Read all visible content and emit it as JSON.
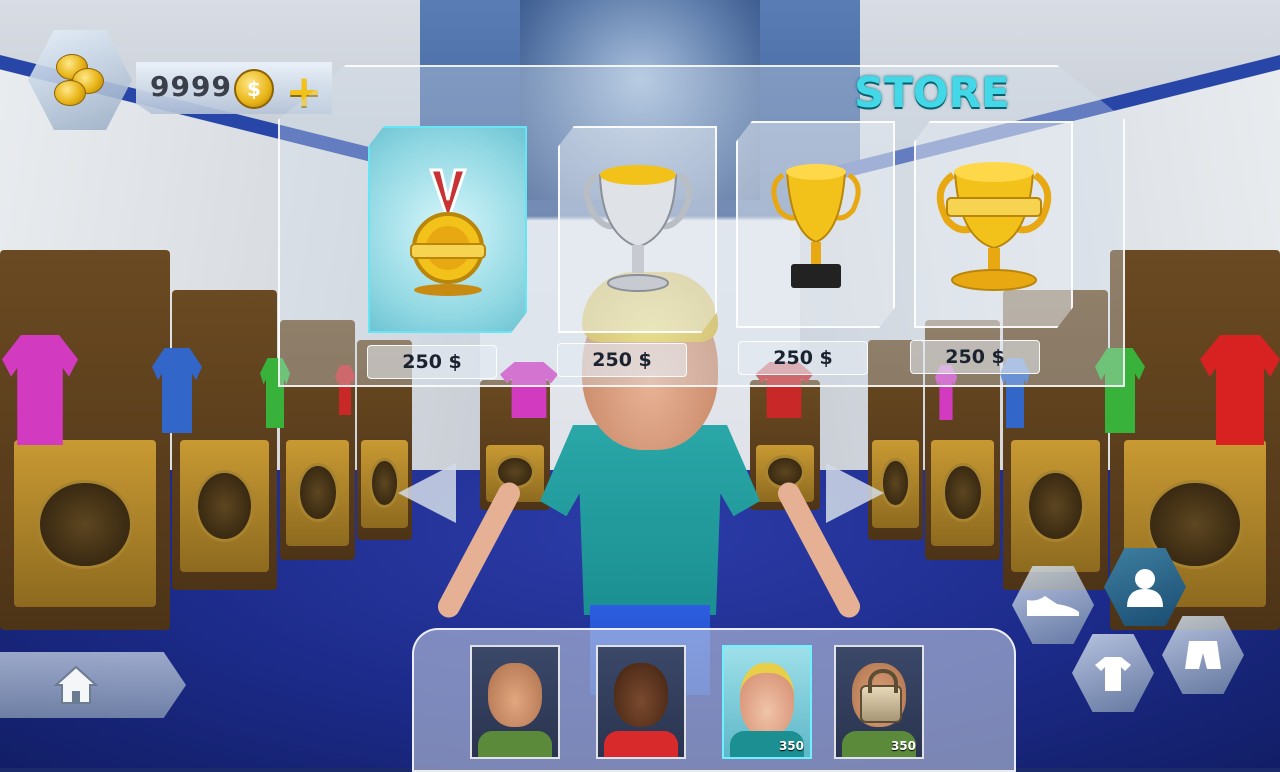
{
  "currency": {
    "balance": "9999",
    "coin_symbol": "$",
    "add_label": "+"
  },
  "store": {
    "title": "STORE",
    "items": [
      {
        "name": "gold-medal",
        "price": "250 $",
        "selected": true
      },
      {
        "name": "silver-cup",
        "price": "250 $",
        "selected": false
      },
      {
        "name": "gold-trophy-small",
        "price": "250 $",
        "selected": false
      },
      {
        "name": "gold-trophy-large",
        "price": "250 $",
        "selected": false
      }
    ]
  },
  "characters": [
    {
      "name": "spiky-hair-boy",
      "price": "",
      "locked": false,
      "selected": false
    },
    {
      "name": "dark-skin-boy",
      "price": "",
      "locked": false,
      "selected": false
    },
    {
      "name": "blonde-boy",
      "price": "350",
      "locked": false,
      "selected": true
    },
    {
      "name": "locked-boy",
      "price": "350",
      "locked": true,
      "selected": false
    }
  ],
  "categories": [
    {
      "name": "shoes",
      "icon": "sneaker-icon",
      "selected": false
    },
    {
      "name": "character",
      "icon": "person-icon",
      "selected": true
    },
    {
      "name": "shirt",
      "icon": "tshirt-icon",
      "selected": false
    },
    {
      "name": "shorts",
      "icon": "shorts-icon",
      "selected": false
    }
  ],
  "colors": {
    "accent": "#42d8e8",
    "coin": "#e8b417",
    "floor": "#1c2b8a"
  }
}
